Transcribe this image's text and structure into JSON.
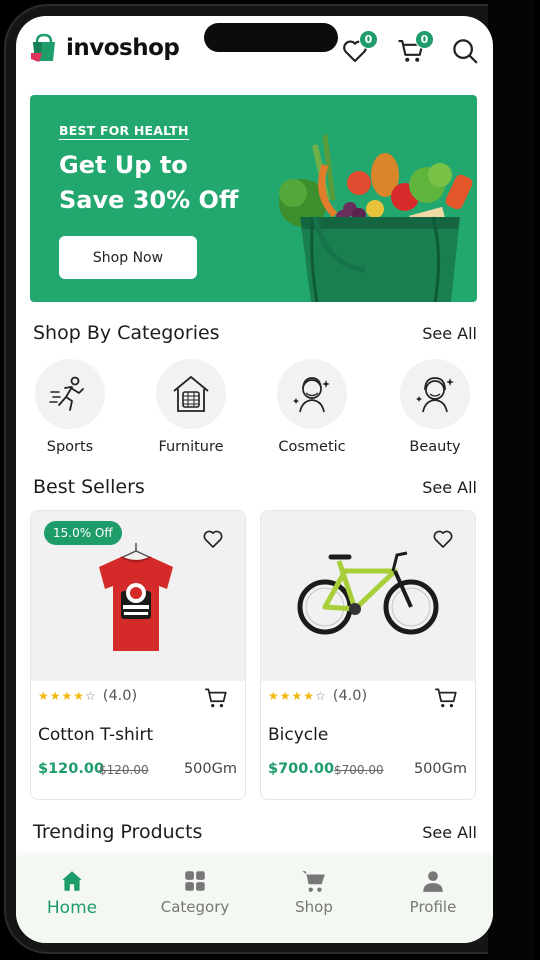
{
  "app": {
    "name": "invoshop",
    "wishlist_count": "0",
    "cart_count": "0"
  },
  "banner": {
    "tag": "BEST FOR HEALTH",
    "title": "Get Up to Save 30% Off",
    "button": "Shop Now"
  },
  "categories": {
    "title": "Shop By Categories",
    "see_all": "See All",
    "items": [
      {
        "label": "Sports",
        "icon": "running-icon"
      },
      {
        "label": "Furniture",
        "icon": "home-furniture-icon"
      },
      {
        "label": "Cosmetic",
        "icon": "cosmetic-face-icon"
      },
      {
        "label": "Beauty",
        "icon": "beauty-face-icon"
      }
    ]
  },
  "best_sellers": {
    "title": "Best Sellers",
    "see_all": "See All",
    "products": [
      {
        "name": "Cotton T-shirt",
        "price": "$120.00",
        "old_price": "$120.00",
        "weight": "500Gm",
        "rating": "(4.0)",
        "discount": "15.0% Off"
      },
      {
        "name": "Bicycle",
        "price": "$700.00",
        "old_price": "$700.00",
        "weight": "500Gm",
        "rating": "(4.0)",
        "discount": ""
      }
    ]
  },
  "trending": {
    "title": "Trending Products",
    "see_all": "See All"
  },
  "nav": {
    "items": [
      {
        "label": "Home",
        "active": true
      },
      {
        "label": "Category",
        "active": false
      },
      {
        "label": "Shop",
        "active": false
      },
      {
        "label": "Profile",
        "active": false
      }
    ]
  },
  "colors": {
    "accent": "#1e9c6a",
    "banner": "#22a76f",
    "star": "#f2b90c"
  }
}
